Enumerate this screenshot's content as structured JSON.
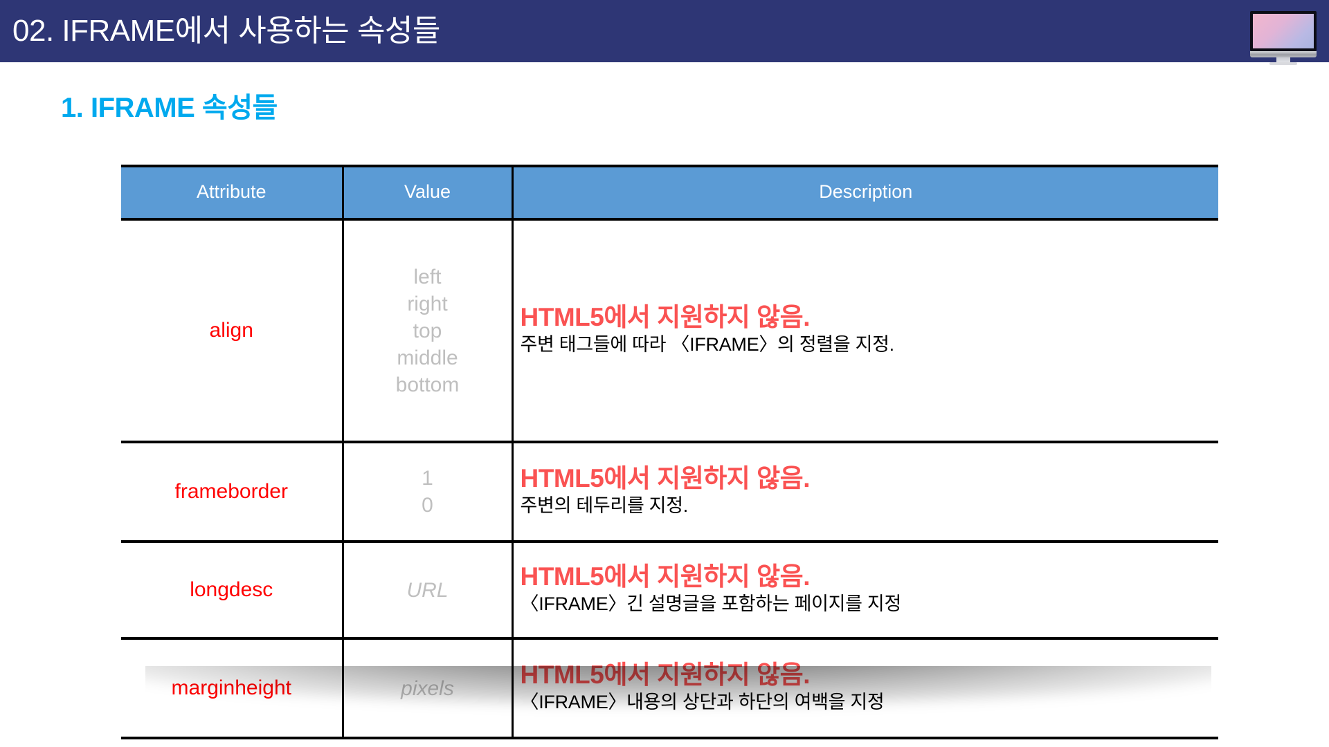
{
  "header": {
    "title": "02. IFRAME에서 사용하는 속성들",
    "bar_color": "#2e3675",
    "icon": "desktop-monitor-icon"
  },
  "subtitle": {
    "text": "1. IFRAME 속성들",
    "color": "#00a9ee"
  },
  "table": {
    "header_bg": "#5b9bd5",
    "attr_color": "#ff0000",
    "value_color": "#bfbfbf",
    "desc_head_color": "#fa5252",
    "columns": [
      "Attribute",
      "Value",
      "Description"
    ],
    "rows": [
      {
        "attribute": "align",
        "values": [
          "left",
          "right",
          "top",
          "middle",
          "bottom"
        ],
        "value_italic": false,
        "desc_head": "HTML5에서 지원하지 않음.",
        "desc_sub": "주변 태그들에 따라 〈IFRAME〉의 정렬을 지정."
      },
      {
        "attribute": "frameborder",
        "values": [
          "1",
          "0"
        ],
        "value_italic": false,
        "desc_head": "HTML5에서 지원하지 않음.",
        "desc_sub": "주변의 테두리를 지정."
      },
      {
        "attribute": "longdesc",
        "values": [
          "URL"
        ],
        "value_italic": true,
        "desc_head": "HTML5에서 지원하지 않음.",
        "desc_sub": "〈IFRAME〉긴 설명글을 포함하는 페이지를 지정"
      },
      {
        "attribute": "marginheight",
        "values": [
          "pixels"
        ],
        "value_italic": true,
        "desc_head": "HTML5에서 지원하지 않음.",
        "desc_sub": "〈IFRAME〉내용의 상단과 하단의 여백을 지정"
      }
    ]
  }
}
